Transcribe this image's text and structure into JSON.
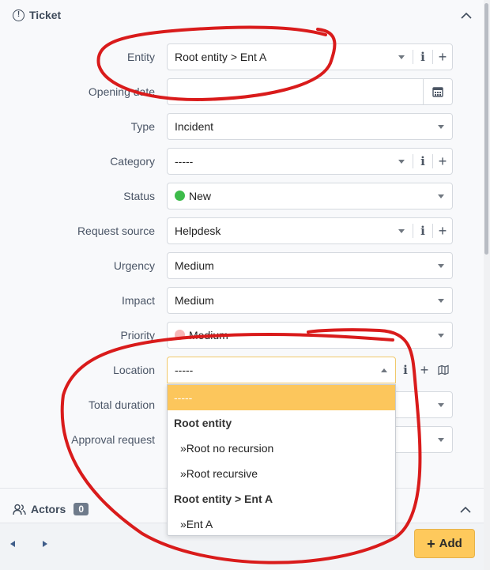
{
  "section": {
    "title": "Ticket",
    "icon": "exclamation-circle-icon"
  },
  "fields": {
    "entity": {
      "label": "Entity",
      "value": "Root entity > Ent A"
    },
    "opening_date": {
      "label": "Opening date",
      "value": ""
    },
    "type": {
      "label": "Type",
      "value": "Incident"
    },
    "category": {
      "label": "Category",
      "value": "-----"
    },
    "status": {
      "label": "Status",
      "value": "New",
      "color": "#3dbb4a"
    },
    "request_source": {
      "label": "Request source",
      "value": "Helpdesk"
    },
    "urgency": {
      "label": "Urgency",
      "value": "Medium"
    },
    "impact": {
      "label": "Impact",
      "value": "Medium"
    },
    "priority": {
      "label": "Priority",
      "value": "Medium",
      "color": "#f8b7b7"
    },
    "location": {
      "label": "Location",
      "value": "-----"
    },
    "total_duration": {
      "label": "Total duration"
    },
    "approval_request": {
      "label": "Approval request"
    }
  },
  "buttons": {
    "info": "i",
    "plus": "+"
  },
  "location_dropdown": {
    "options": [
      {
        "label": "-----",
        "kind": "selected"
      },
      {
        "label": "Root entity",
        "kind": "group"
      },
      {
        "label": "»Root no recursion",
        "kind": "child"
      },
      {
        "label": "»Root recursive",
        "kind": "child"
      },
      {
        "label": "Root entity > Ent A",
        "kind": "group"
      },
      {
        "label": "»Ent A",
        "kind": "child"
      }
    ]
  },
  "actors": {
    "label": "Actors",
    "count": "0",
    "icon": "users-icon"
  },
  "footer": {
    "add_label": "Add",
    "add_color": "#fec95c"
  },
  "annotation_color": "#d91b1b"
}
